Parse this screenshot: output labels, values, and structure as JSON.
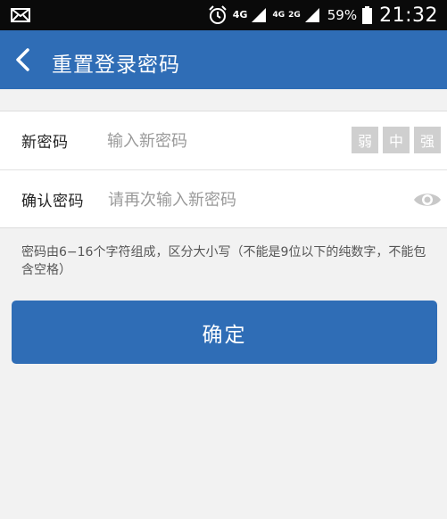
{
  "status_bar": {
    "net_4g": "4G",
    "net_4g_small": "4G",
    "net_2g": "2G",
    "battery_percent": "59%",
    "time": "21:32",
    "icons": [
      "mail-icon",
      "alarm-icon",
      "signal-icon",
      "battery-icon"
    ]
  },
  "header": {
    "title": "重置登录密码",
    "back_icon": "chevron-left-icon"
  },
  "form": {
    "new_password": {
      "label": "新密码",
      "placeholder": "输入新密码",
      "value": ""
    },
    "strength": {
      "weak": "弱",
      "medium": "中",
      "strong": "强"
    },
    "confirm_password": {
      "label": "确认密码",
      "placeholder": "请再次输入新密码",
      "value": "",
      "toggle_icon": "eye-icon"
    }
  },
  "hint": "密码由6−16个字符组成，区分大小写（不能是9位以下的纯数字，不能包含空格）",
  "confirm_button": "确定",
  "colors": {
    "primary": "#2f6db6",
    "status_bar": "#0a0a0a",
    "background": "#f2f2f2",
    "strength_inactive": "#cfcfcf"
  }
}
